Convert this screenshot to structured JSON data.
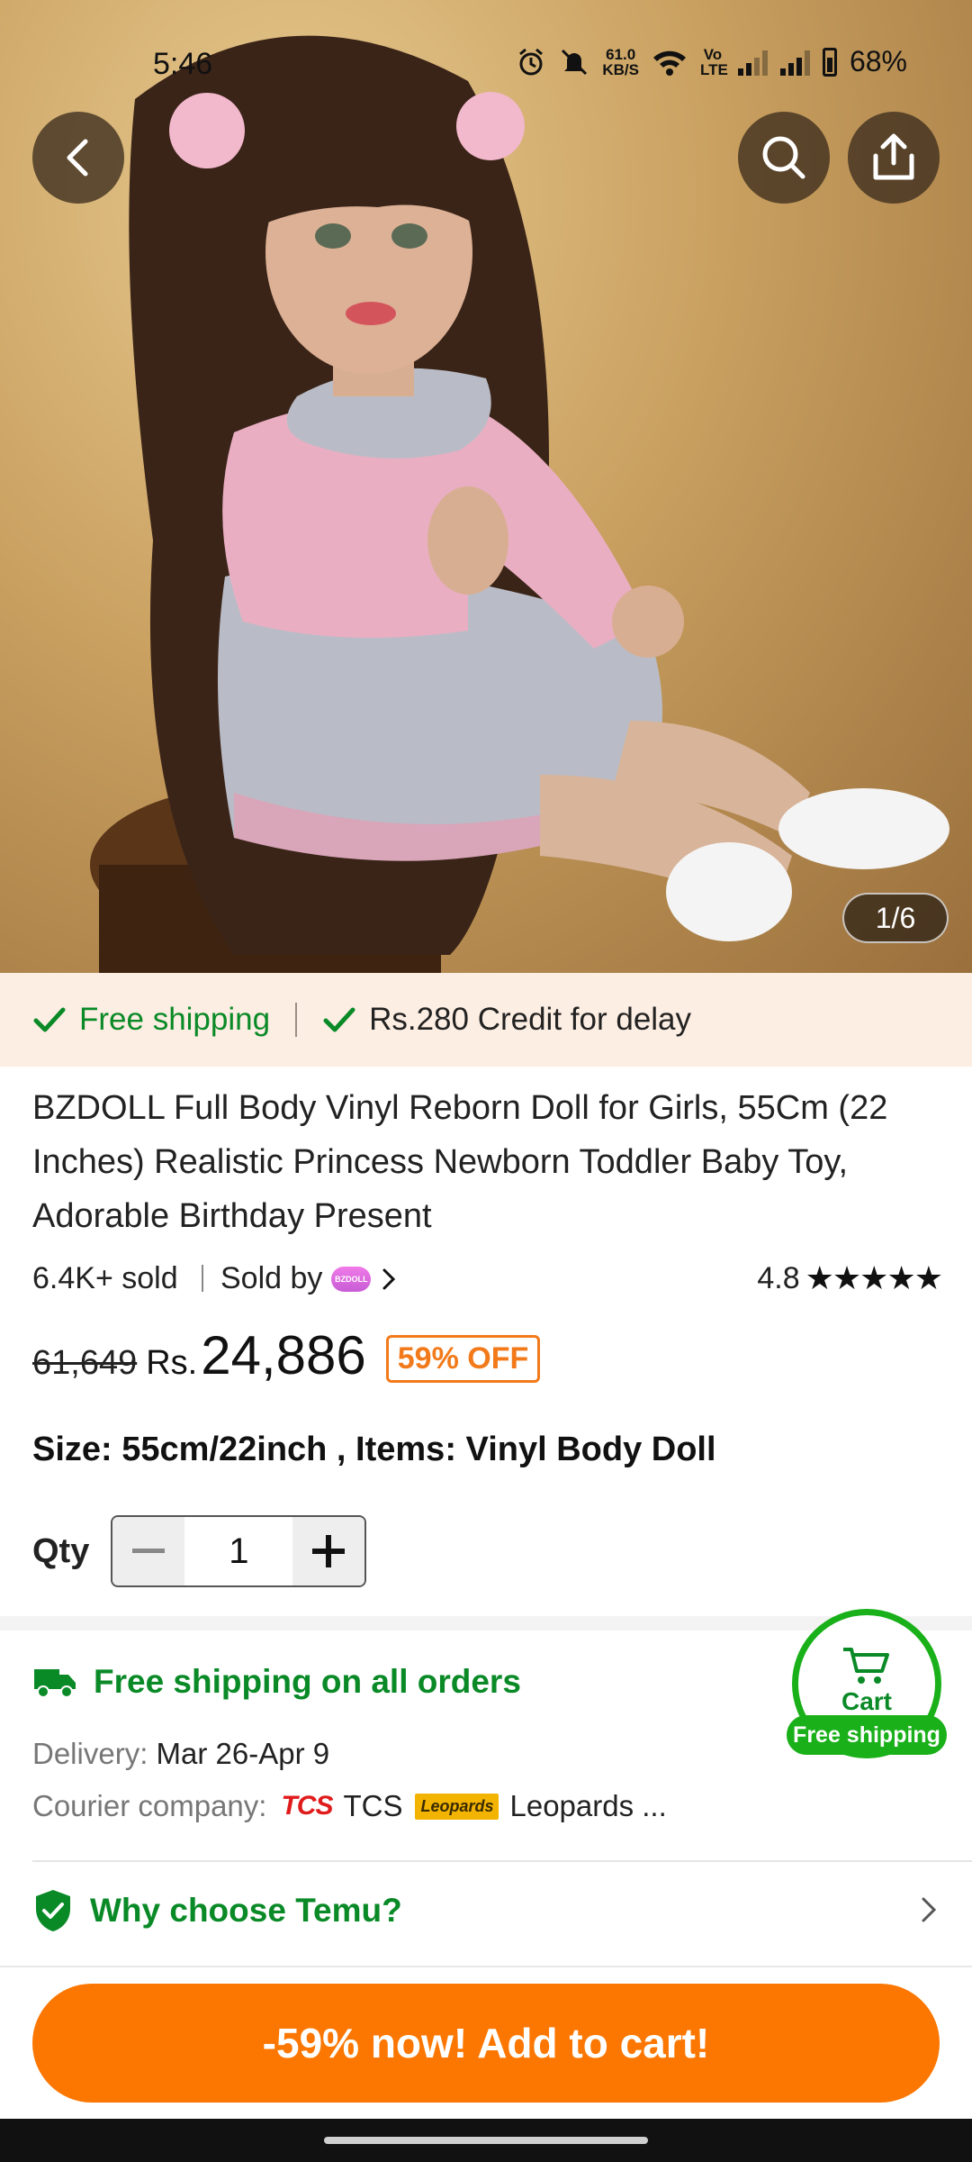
{
  "status_bar": {
    "time": "5:46",
    "network_speed_value": "61.0",
    "network_speed_unit": "KB/S",
    "volte": "Vo LTE",
    "battery": "68%"
  },
  "hero": {
    "image_pager": "1/6",
    "icons": [
      "back-arrow-icon",
      "search-icon",
      "share-icon"
    ]
  },
  "shipping_strip": {
    "item1": "Free shipping",
    "item2": "Rs.280 Credit for delay"
  },
  "product": {
    "title": "BZDOLL Full Body Vinyl Reborn Doll for Girls, 55Cm (22 Inches) Realistic Princess Newborn Toddler Baby Toy, Adorable Birthday Present",
    "sold_count": "6.4K+ sold",
    "sold_by_label": "Sold by",
    "seller_logo_text": "BZDOLL",
    "rating": "4.8",
    "stars": 5,
    "original_price": "61,649",
    "currency": "Rs.",
    "price": "24,886",
    "discount": "59% OFF",
    "variant": "Size: 55cm/22inch , Items: Vinyl Body Doll",
    "qty_label": "Qty",
    "qty_value": "1"
  },
  "shipping_info": {
    "headline": "Free shipping on all orders",
    "delivery_label": "Delivery:",
    "delivery_value": "Mar 26-Apr 9",
    "courier_label": "Courier company:",
    "courier1_logo": "TCS",
    "courier1": "TCS",
    "courier2_logo": "Leopards",
    "courier2": "Leopards ..."
  },
  "cart_badge": {
    "label": "Cart",
    "sublabel": "Free shipping"
  },
  "why_choose": {
    "label": "Why choose Temu?"
  },
  "cta": {
    "label": "-59% now! Add to cart!"
  },
  "colors": {
    "green": "#0a8a27",
    "orange": "#fb7701",
    "strip_bg": "#fdeee3"
  }
}
